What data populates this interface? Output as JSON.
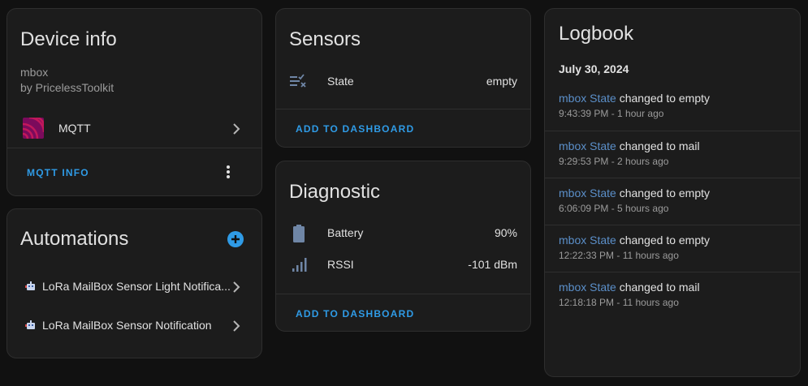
{
  "device_info": {
    "title": "Device info",
    "device_name": "mbox",
    "manufacturer": "by PricelessToolkit",
    "integration_label": "MQTT",
    "action_label": "MQTT INFO",
    "integration_icon": "mqtt-icon"
  },
  "automations": {
    "title": "Automations",
    "items": [
      {
        "label": "LoRa MailBox Sensor Light Notifica...",
        "icon": "robot-icon"
      },
      {
        "label": "LoRa MailBox Sensor Notification",
        "icon": "robot-icon"
      }
    ]
  },
  "sensors": {
    "title": "Sensors",
    "rows": [
      {
        "label": "State",
        "value": "empty",
        "icon": "list-status-icon"
      }
    ],
    "action_label": "ADD TO DASHBOARD"
  },
  "diagnostic": {
    "title": "Diagnostic",
    "rows": [
      {
        "label": "Battery",
        "value": "90%",
        "icon": "battery-icon"
      },
      {
        "label": "RSSI",
        "value": "-101 dBm",
        "icon": "signal-icon"
      }
    ],
    "action_label": "ADD TO DASHBOARD"
  },
  "logbook": {
    "title": "Logbook",
    "date": "July 30, 2024",
    "entries": [
      {
        "entity": "mbox State",
        "message": "changed to empty",
        "time": "9:43:39 PM - 1 hour ago"
      },
      {
        "entity": "mbox State",
        "message": "changed to mail",
        "time": "9:29:53 PM - 2 hours ago"
      },
      {
        "entity": "mbox State",
        "message": "changed to empty",
        "time": "6:06:09 PM - 5 hours ago"
      },
      {
        "entity": "mbox State",
        "message": "changed to empty",
        "time": "12:22:33 PM - 11 hours ago"
      },
      {
        "entity": "mbox State",
        "message": "changed to mail",
        "time": "12:18:18 PM - 11 hours ago"
      }
    ]
  },
  "colors": {
    "accent": "#2f9be6",
    "entity_link": "#5b8fc9",
    "mqtt": "#7b0b5c",
    "card_bg": "#1c1c1c",
    "page_bg": "#111111"
  }
}
